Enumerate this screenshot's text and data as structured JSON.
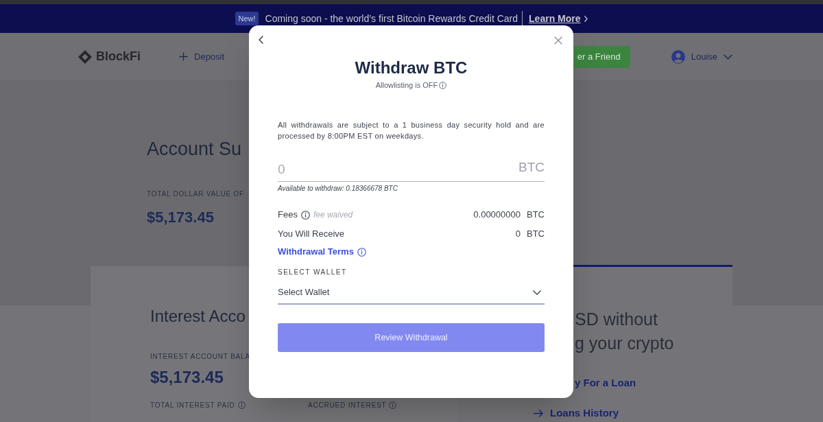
{
  "banner": {
    "badge": "New!",
    "message": "Coming soon - the world’s first Bitcoin Rewards Credit Card",
    "link": "Learn More"
  },
  "navbar": {
    "brand": "BlockFi",
    "deposit_link": "Deposit",
    "referral_button": "er a Friend",
    "user_name": "Louise"
  },
  "account_summary": {
    "title": "Account Su",
    "total_label": "TOTAL DOLLAR VALUE OF",
    "total_value": "$5,173.45"
  },
  "interest_card": {
    "title": "Interest Acco",
    "balance_label": "INTEREST ACCOUNT BALA",
    "balance_value": "$5,173.45",
    "stats": [
      {
        "label": "TOTAL INTEREST PAID"
      },
      {
        "label": "ACCRUED INTEREST"
      }
    ]
  },
  "loan_card": {
    "heading_lines": [
      "SD without",
      "g your crypto"
    ],
    "apply_link": "y For a Loan",
    "history_link": "Loans History"
  },
  "withdraw_dialog": {
    "title": "Withdraw BTC",
    "allowlisting": "Allowlisting is OFF",
    "notice": "All withdrawals are subject to a 1 business day security hold and are processed by 8:00PM EST on weekdays.",
    "amount_field": {
      "placeholder": "0",
      "unit": "BTC"
    },
    "available": "Available to withdraw: 0.18366678 BTC",
    "summary_rows": [
      {
        "label": "Fees",
        "info": true,
        "note": "fee waived",
        "amount": "0.00000000",
        "unit": "BTC"
      },
      {
        "label": "You Will Receive",
        "info": false,
        "amount": "0",
        "unit": "BTC"
      }
    ],
    "terms_link": "Withdrawal Terms",
    "wallet_label": "SELECT WALLET",
    "wallet_select": {
      "value": "Select Wallet"
    },
    "submit_button": {
      "label": "Review Withdrawal",
      "disabled": true
    }
  }
}
